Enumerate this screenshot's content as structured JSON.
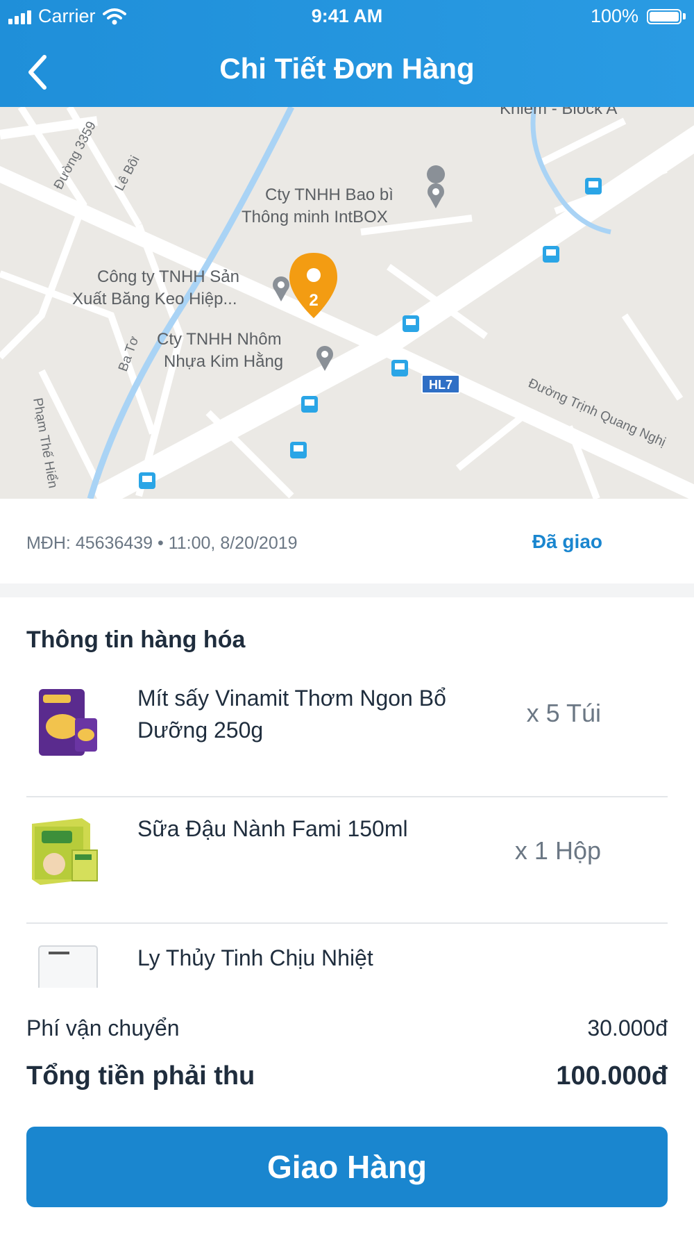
{
  "status_bar": {
    "carrier": "Carrier",
    "time": "9:41 AM",
    "battery": "100%"
  },
  "header": {
    "title": "Chi Tiết Đơn Hàng",
    "back_icon": "chevron-left-icon"
  },
  "map": {
    "places": [
      "Khiem - Block A",
      "Cty TNHH Bao bì",
      "Thông minh IntBOX",
      "Công ty TNHH Sản",
      "Xuất Băng Keo Hiệp...",
      "Cty TNHH Nhôm",
      "Nhựa Kim Hằng",
      "Đường Trịnh Quang Nghị",
      "Phạm Thế Hiển",
      "Đường 3359",
      "Lê Bôi",
      "Ba Tơ"
    ],
    "road_badge": "HL7",
    "marker_label": "2",
    "accent": "#f39c12"
  },
  "order": {
    "code_text": "MĐH: 45636439",
    "time_text": "11:00, 8/20/2019",
    "status": "Đã giao",
    "status_color": "#1a86cf"
  },
  "goods": {
    "title": "Thông tin hàng hóa",
    "items": [
      {
        "name": "Mít sấy Vinamit Thơm Ngon Bổ Dưỡng 250g",
        "qty": "x 5 Túi"
      },
      {
        "name": "Sữa Đậu Nành Fami 150ml",
        "qty": "x 1 Hộp"
      },
      {
        "name": "Ly Thủy Tinh Chịu Nhiệt",
        "qty": ""
      }
    ]
  },
  "summary": {
    "shipping_label": "Phí vận chuyển",
    "shipping_value": "30.000đ",
    "total_label": "Tổng tiền phải thu",
    "total_value": "100.000đ"
  },
  "cta": {
    "label": "Giao Hàng",
    "color": "#1a86cf"
  }
}
